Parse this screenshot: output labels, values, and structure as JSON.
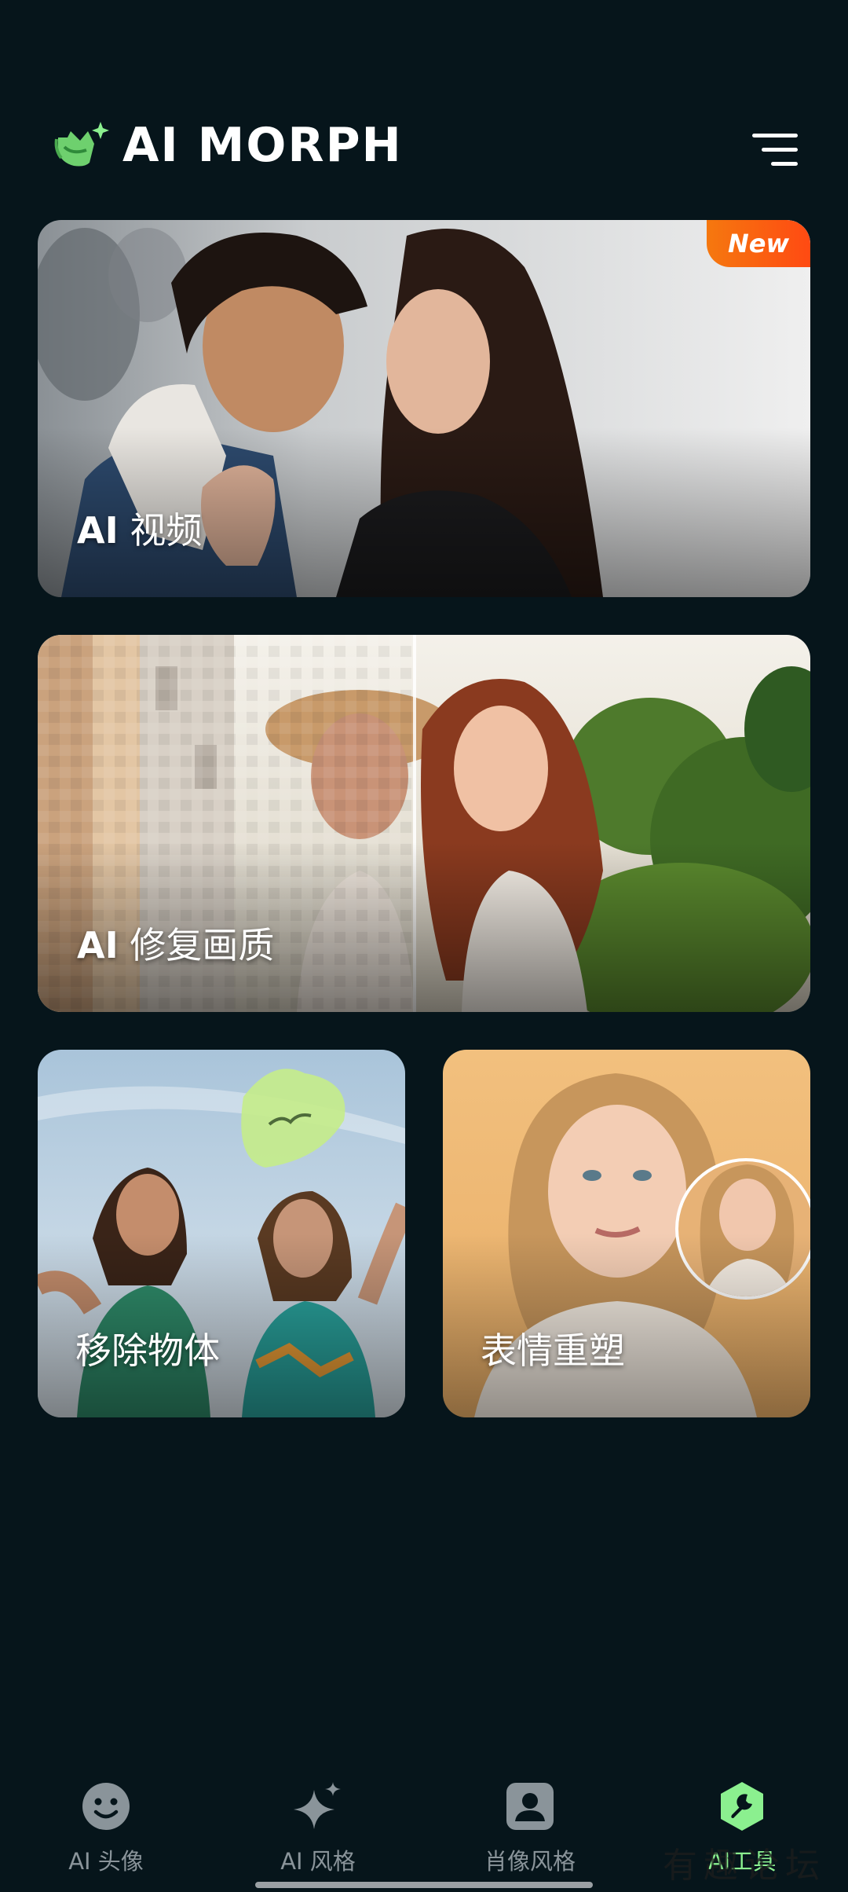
{
  "header": {
    "logo_text": "AI MORPH"
  },
  "cards": {
    "video": {
      "prefix": "AI",
      "label": "视频",
      "badge": "New"
    },
    "restore": {
      "prefix": "AI",
      "label": "修复画质"
    },
    "remove": {
      "label": "移除物体"
    },
    "expression": {
      "label": "表情重塑"
    }
  },
  "nav": {
    "items": [
      {
        "label": "AI 头像",
        "icon": "smiley-icon",
        "active": false
      },
      {
        "label": "AI 风格",
        "icon": "sparkle-icon",
        "active": false
      },
      {
        "label": "肖像风格",
        "icon": "portrait-icon",
        "active": false
      },
      {
        "label": "AI工具",
        "icon": "wrench-icon",
        "active": true
      }
    ]
  },
  "watermark": "有趣论坛",
  "colors": {
    "background": "#06151b",
    "accent_green": "#8bf08f",
    "badge_orange": "#f5780f",
    "inactive_gray": "#8a949a"
  }
}
